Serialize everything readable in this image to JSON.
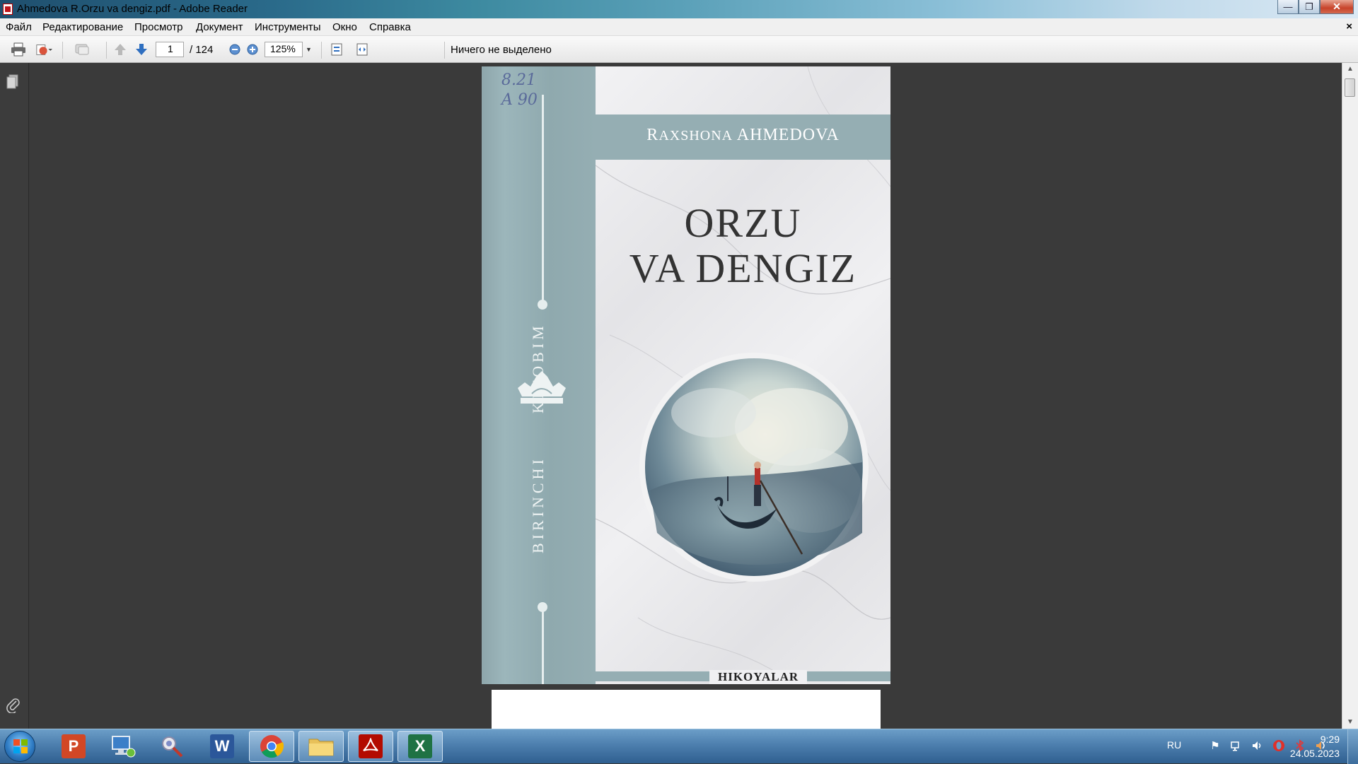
{
  "window": {
    "title": "Ahmedova R.Orzu va dengiz.pdf - Adobe Reader",
    "buttons": {
      "minimize": "—",
      "maximize": "❐",
      "close": "✕"
    }
  },
  "menu": {
    "items": [
      "Файл",
      "Редактирование",
      "Просмотр",
      "Документ",
      "Инструменты",
      "Окно",
      "Справка"
    ],
    "close_document": "×"
  },
  "toolbar": {
    "page_current": "1",
    "page_total": "/ 124",
    "zoom": "125%",
    "selection_status": "Ничего не выделено"
  },
  "document": {
    "author": "Raxshona AHMEDOVA",
    "author_cap_1": "R",
    "author_rest_1": "AXSHONA",
    "author_name_2": "AHMEDOVA",
    "title_line1": "ORZU",
    "title_line2": "VA DENGIZ",
    "spine_text_upper": "KITOBIM",
    "spine_text_lower": "BIRINCHI",
    "handwritten_line1": "8.21",
    "handwritten_line2": "A 90",
    "genre": "HIKOYALAR"
  },
  "taskbar": {
    "language": "RU",
    "time": "9:29",
    "date": "24.05.2023",
    "apps": [
      "powerpoint",
      "computer",
      "tool",
      "word",
      "chrome",
      "explorer",
      "adobe-reader",
      "excel"
    ]
  },
  "colors": {
    "spine": "#95aeb3",
    "reader_bg": "#3a3a3a",
    "taskbar": "#4d7fae"
  }
}
